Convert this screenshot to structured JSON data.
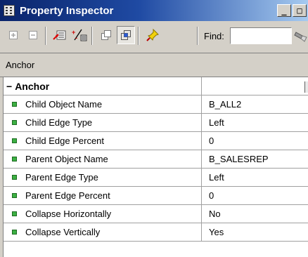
{
  "window": {
    "title": "Property Inspector",
    "controls": {
      "minimize": "_",
      "restore": "□"
    }
  },
  "toolbar": {
    "buttons": [
      {
        "icon": "expand-all-icon"
      },
      {
        "icon": "collapse-all-icon"
      },
      {
        "icon": "localize-icon"
      },
      {
        "icon": "sort-icon"
      },
      {
        "icon": "union-icon"
      },
      {
        "icon": "intersection-icon"
      },
      {
        "icon": "freeze-pin-icon"
      }
    ],
    "find_label": "Find:",
    "find_value": "",
    "find_go_icon": "flashlight-icon"
  },
  "breadcrumb": "Anchor",
  "group": {
    "label": "Anchor",
    "glyph": "−"
  },
  "properties": [
    {
      "name": "Child Object Name",
      "value": "B_ALL2"
    },
    {
      "name": "Child Edge Type",
      "value": "Left"
    },
    {
      "name": "Child Edge Percent",
      "value": "0"
    },
    {
      "name": "Parent Object Name",
      "value": "B_SALESREP"
    },
    {
      "name": "Parent Edge Type",
      "value": "Left"
    },
    {
      "name": "Parent Edge Percent",
      "value": "0"
    },
    {
      "name": "Collapse Horizontally",
      "value": "No"
    },
    {
      "name": "Collapse Vertically",
      "value": "Yes"
    }
  ],
  "colors": {
    "title_gradient_start": "#0a246a",
    "title_gradient_end": "#a6caf0",
    "property_bullet": "#3cb043",
    "chrome": "#d4d0c8"
  }
}
